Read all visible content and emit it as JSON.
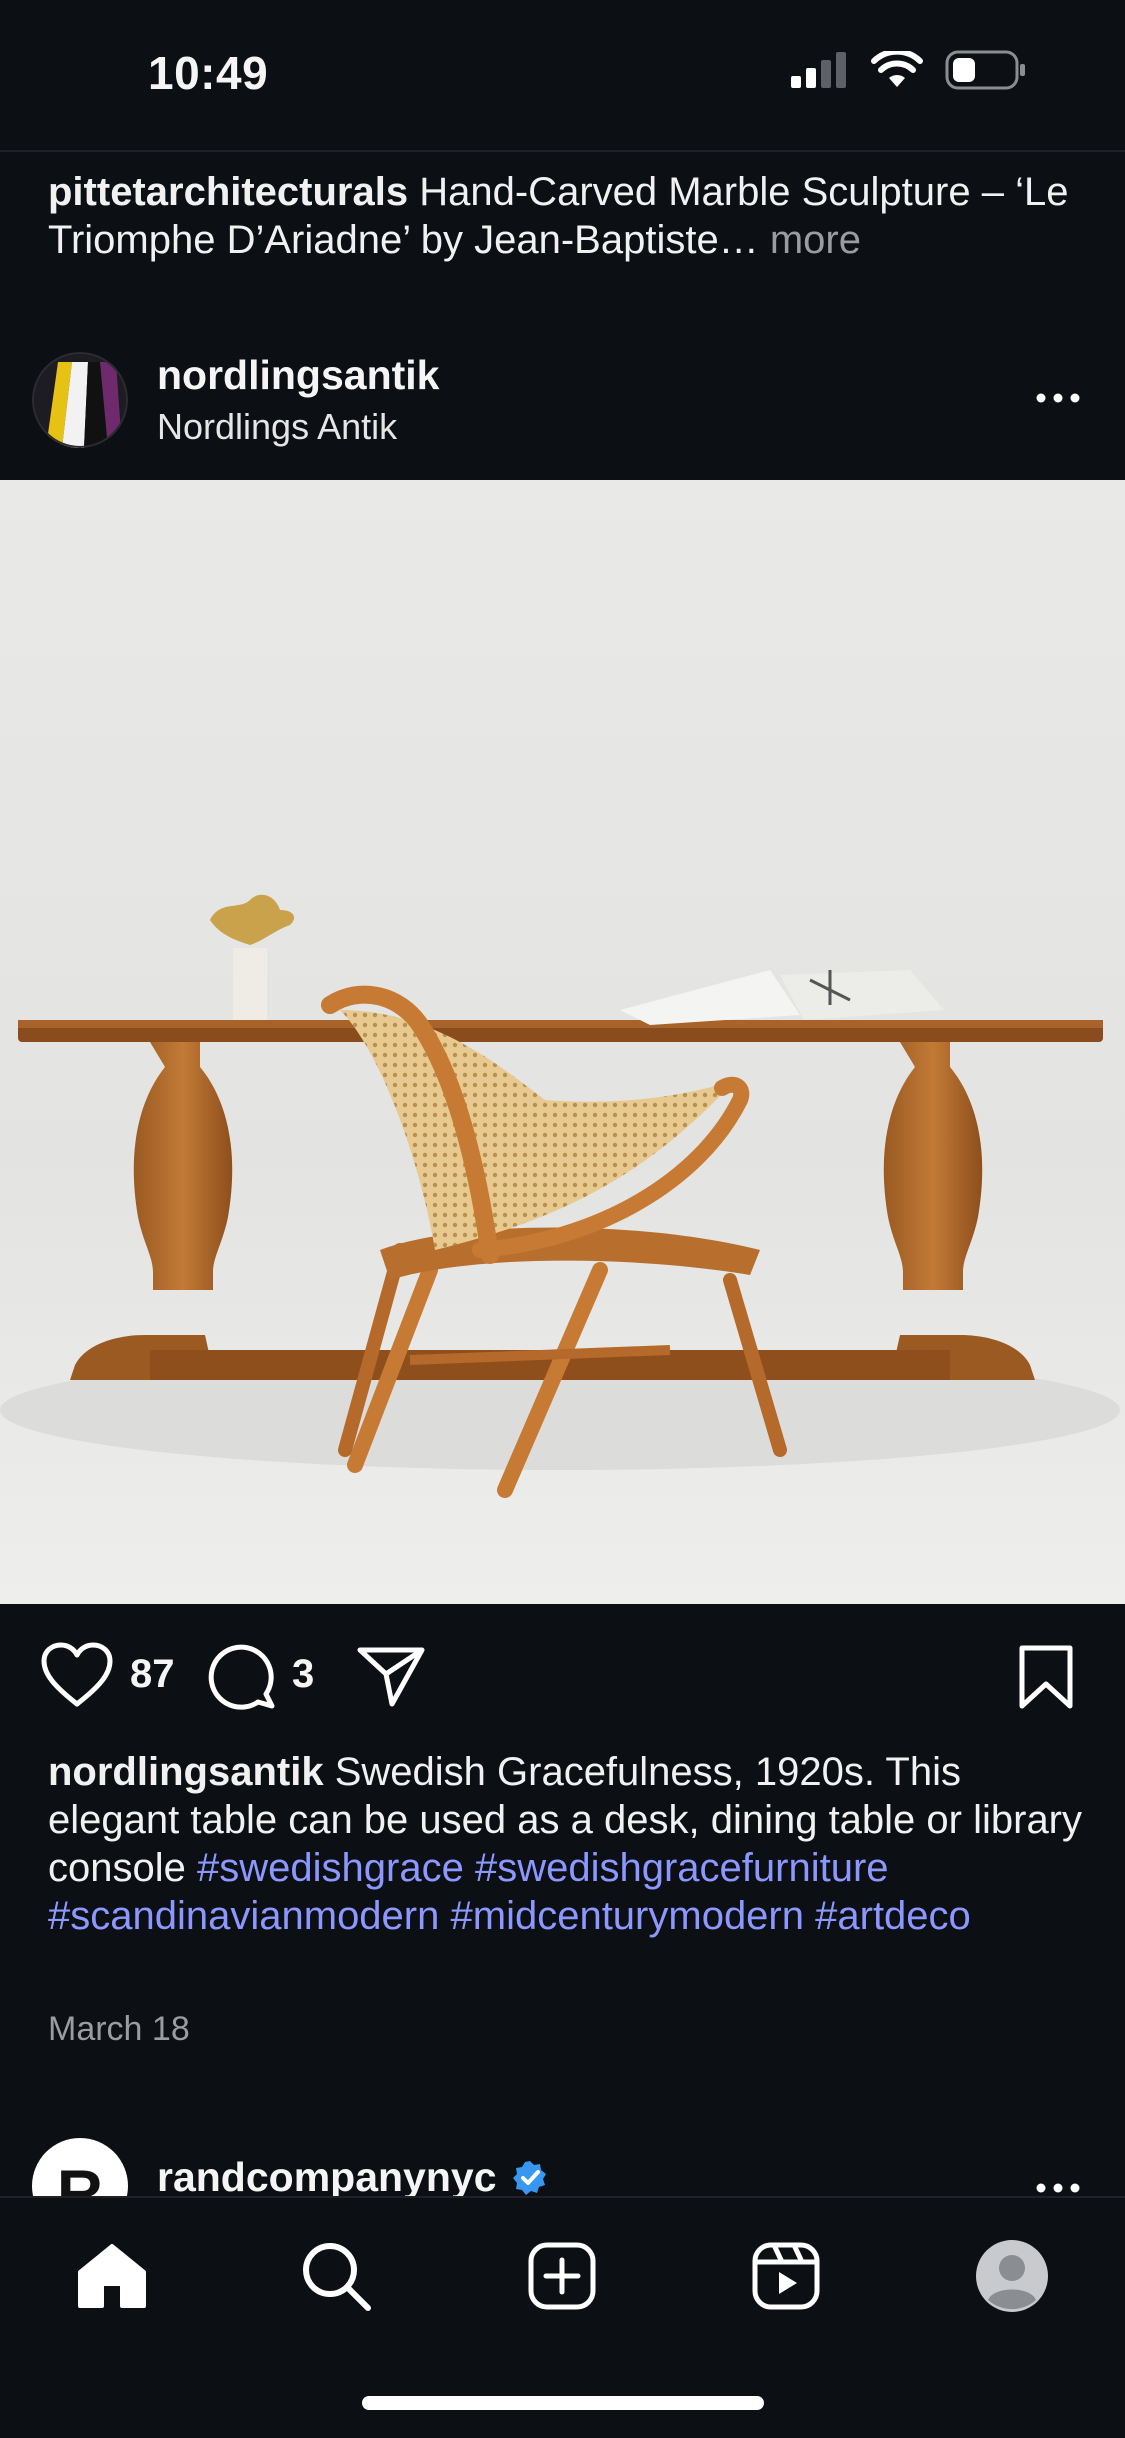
{
  "status_bar": {
    "time": "10:49"
  },
  "previous_post": {
    "username": "pittetarchitecturals",
    "caption": "Hand-Carved Marble Sculpture – ‘Le Triomphe D’Ariadne’ by Jean-Baptiste…",
    "more_label": "more"
  },
  "post": {
    "username": "nordlingsantik",
    "subtitle": "Nordlings Antik",
    "likes": "87",
    "comments": "3",
    "caption_text": "Swedish Gracefulness, 1920s. This elegant table can be used as a desk, dining table or library console",
    "hashtags": [
      "#swedishgrace",
      "#swedishgracefurniture",
      "#scandinavianmodern",
      "#midcenturymodern",
      "#artdeco"
    ],
    "date": "March 18"
  },
  "next_post": {
    "username": "randcompanynyc",
    "avatar_letter": "R",
    "verified": true
  },
  "tab_bar": {
    "items": [
      "home-icon",
      "search-icon",
      "create-icon",
      "reels-icon",
      "profile-icon"
    ],
    "active": "home-icon"
  },
  "colors": {
    "background": "#0c0f14",
    "hashtag": "#8c98ff",
    "verified": "#3897f0",
    "muted": "#9a9ca1"
  }
}
